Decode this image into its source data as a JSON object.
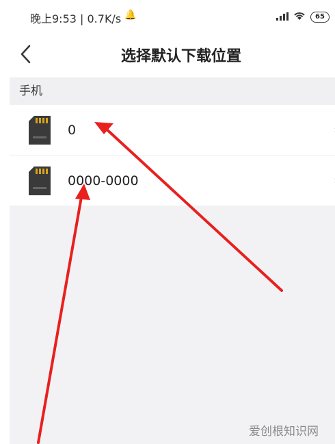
{
  "status_bar": {
    "time_text": "晚上9:53 | 0.7K/s",
    "battery": "65",
    "icons": [
      "bell-icon",
      "signal-icon",
      "wifi-icon",
      "battery-icon"
    ]
  },
  "header": {
    "title": "选择默认下载位置",
    "back_icon": "chevron-left-icon"
  },
  "section": {
    "title": "手机"
  },
  "storage_items": [
    {
      "label": "0",
      "icon": "sd-card-icon"
    },
    {
      "label": "0000-0000",
      "icon": "sd-card-icon"
    }
  ],
  "watermark": "爱创根知识网",
  "colors": {
    "arrow": "#e8201e",
    "section_bg": "#f0f0f2",
    "content_bg": "#f2f2f4"
  }
}
